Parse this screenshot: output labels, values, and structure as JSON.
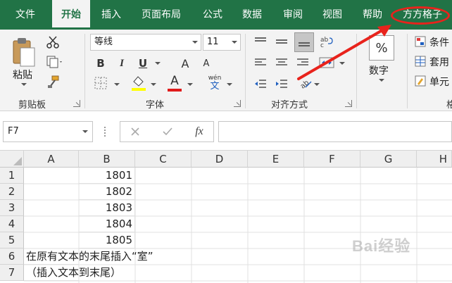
{
  "tabs": [
    "文件",
    "开始",
    "插入",
    "页面布局",
    "公式",
    "数据",
    "审阅",
    "视图",
    "帮助",
    "方方格子"
  ],
  "active_tab": "开始",
  "clipboard": {
    "paste_label": "粘贴",
    "group_label": "剪贴板"
  },
  "font": {
    "name": "等线",
    "size": "11",
    "group_label": "字体",
    "bold": "B",
    "italic": "I",
    "underline": "U",
    "grow": "A",
    "shrink": "A",
    "font_color_letter": "A",
    "phonetic": "wén",
    "phonetic_char": "文"
  },
  "alignment": {
    "group_label": "对齐方式"
  },
  "number": {
    "label": "数字",
    "percent": "%"
  },
  "styles": {
    "item1": "条件",
    "item2": "套用",
    "item3": "单元"
  },
  "right_partial": "格",
  "formula_bar": {
    "name_box": "F7",
    "fx": "fx"
  },
  "columns": [
    "A",
    "B",
    "C",
    "D",
    "E",
    "F",
    "G",
    "H"
  ],
  "rows": [
    "1",
    "2",
    "3",
    "4",
    "5",
    "6",
    "7"
  ],
  "cells": {
    "B1": "1801",
    "B2": "1802",
    "B3": "1803",
    "B4": "1804",
    "B5": "1805",
    "A6": "在原有文本的末尾插入“室”",
    "A7": "（插入文本到末尾）"
  },
  "watermark": "Bai经验",
  "colors": {
    "accent": "#217346",
    "annotation": "#e8231c"
  }
}
